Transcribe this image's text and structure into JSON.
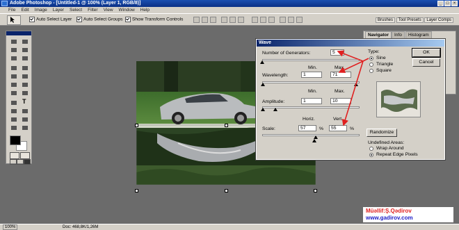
{
  "window": {
    "title": "Adobe Photoshop - [Untitled-1 @ 100% (Layer 1, RGB/8)]"
  },
  "menu": [
    "File",
    "Edit",
    "Image",
    "Layer",
    "Select",
    "Filter",
    "View",
    "Window",
    "Help"
  ],
  "options_bar": {
    "auto_select_layer": "Auto Select Layer",
    "auto_select_groups": "Auto Select Groups",
    "show_transform_controls": "Show Transform Controls"
  },
  "palette_well": {
    "tabs": [
      "Brushes",
      "Tool Presets",
      "Layer Comps"
    ]
  },
  "navigator": {
    "tabs": [
      "Navigator",
      "Info",
      "Histogram"
    ]
  },
  "dialog": {
    "title": "Wave",
    "number_of_generators": {
      "label": "Number of Generators:",
      "value": "5"
    },
    "wavelength": {
      "label": "Wavelength:",
      "min_label": "Min.",
      "max_label": "Max.",
      "min": "1",
      "max": "71"
    },
    "amplitude": {
      "label": "Amplitude:",
      "min_label": "Min.",
      "max_label": "Max.",
      "min": "1",
      "max": "10"
    },
    "scale": {
      "label": "Scale:",
      "horiz_label": "Horiz.",
      "vert_label": "Vert.",
      "horiz": "57",
      "vert": "55",
      "unit": "%"
    },
    "type": {
      "label": "Type:",
      "options": [
        "Sine",
        "Triangle",
        "Square"
      ],
      "selected": "Sine"
    },
    "ok": "OK",
    "cancel": "Cancel",
    "randomize": "Randomize",
    "undefined_areas": {
      "label": "Undefined Areas:",
      "options": [
        "Wrap Around",
        "Repeat Edge Pixels"
      ],
      "selected": "Repeat Edge Pixels"
    }
  },
  "status": {
    "zoom": "100%",
    "doc": "Doc: 468,8K/1,26M"
  },
  "credit": {
    "name": "Müəllif:Ş.Qədirov",
    "url": "www.gadirov.com"
  },
  "colors": {
    "arrow": "#e02020",
    "credit_name": "#e02020",
    "credit_url": "#2020c8"
  }
}
